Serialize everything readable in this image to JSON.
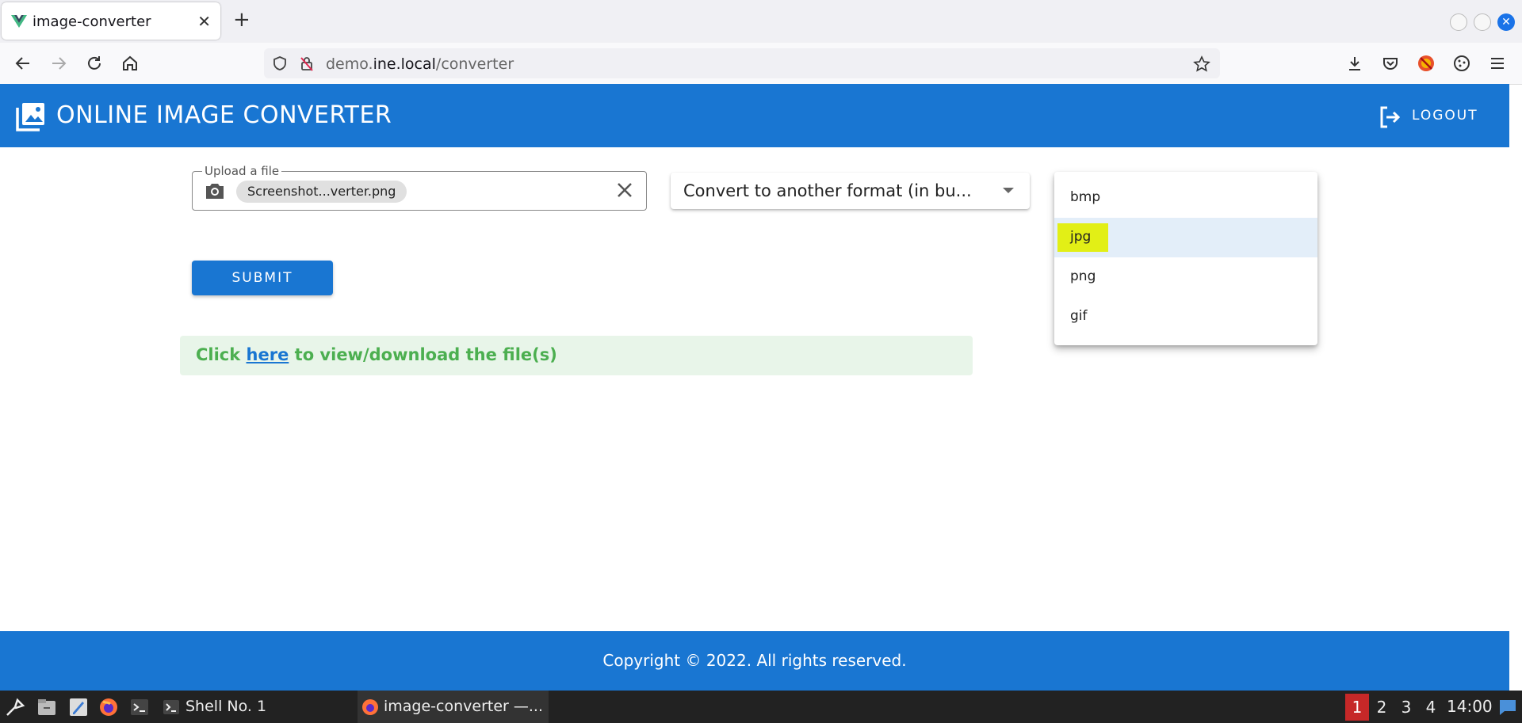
{
  "browser": {
    "tab_title": "image-converter",
    "url_prefix": "demo.",
    "url_host": "ine.local",
    "url_path": "/converter"
  },
  "app": {
    "title": "ONLINE IMAGE CONVERTER",
    "logout_label": "LOGOUT"
  },
  "form": {
    "upload_label": "Upload a file",
    "file_chip": "Screenshot...verter.png",
    "select_value": "Convert to another format (in bu...",
    "submit_label": "SUBMIT"
  },
  "format_menu": {
    "options": [
      "bmp",
      "jpg",
      "png",
      "gif"
    ],
    "highlighted": "jpg"
  },
  "alert": {
    "prefix": "Click ",
    "link": "here",
    "suffix": " to view/download the file(s)"
  },
  "footer": {
    "text": "Copyright © 2022. All rights reserved."
  },
  "taskbar": {
    "task1": "Shell No. 1",
    "task2": "image-converter —...",
    "workspaces": [
      "1",
      "2",
      "3",
      "4"
    ],
    "clock": "14:00"
  },
  "colors": {
    "primary": "#1976d2",
    "alert_text": "#4caf50",
    "highlight": "#e2ef16"
  }
}
